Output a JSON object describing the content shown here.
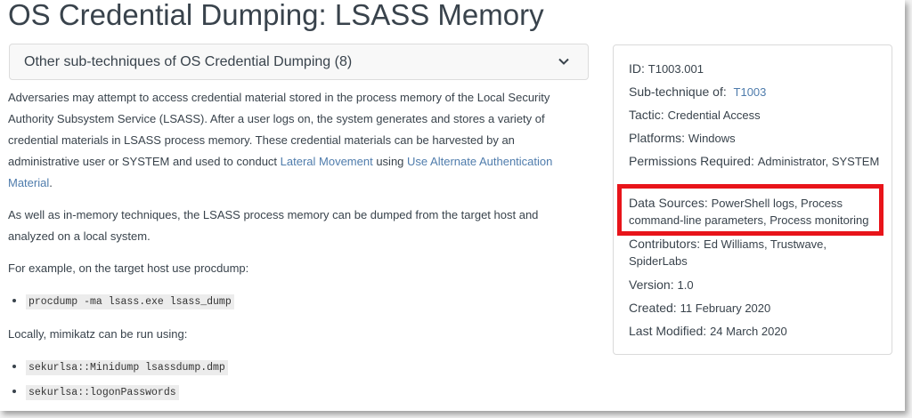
{
  "page": {
    "title": "OS Credential Dumping: LSASS Memory"
  },
  "subtechniques_dropdown": {
    "label": "Other sub-techniques of OS Credential Dumping (8)",
    "icon": "chevron-down-icon"
  },
  "body": {
    "p1_text": "Adversaries may attempt to access credential material stored in the process memory of the Local Security Authority Subsystem Service (LSASS). After a user logs on, the system generates and stores a variety of credential materials in LSASS process memory. These credential materials can be harvested by an administrative user or SYSTEM and used to conduct ",
    "p1_link1": "Lateral Movement",
    "p1_mid": " using ",
    "p1_link2": "Use Alternate Authentication Material",
    "p1_end": ".",
    "p2": "As well as in-memory techniques, the LSASS process memory can be dumped from the target host and analyzed on a local system.",
    "p3": "For example, on the target host use procdump:",
    "procdump_cmd": "procdump -ma lsass.exe lsass_dump",
    "p4": "Locally, mimikatz can be run using:",
    "mimikatz_cmd1": "sekurlsa::Minidump lsassdump.dmp",
    "mimikatz_cmd2": "sekurlsa::logonPasswords"
  },
  "card": {
    "id_label": "ID:",
    "id_value": "T1003.001",
    "subtech_label": "Sub-technique of:",
    "subtech_link": "T1003",
    "tactic_label": "Tactic:",
    "tactic_value": "Credential Access",
    "platforms_label": "Platforms:",
    "platforms_value": "Windows",
    "permissions_label": "Permissions Required:",
    "permissions_value": "Administrator, SYSTEM",
    "datasources_label": "Data Sources:",
    "datasources_value": "PowerShell logs, Process command-line parameters, Process monitoring",
    "contributors_label": "Contributors:",
    "contributors_value": "Ed Williams, Trustwave, SpiderLabs",
    "version_label": "Version:",
    "version_value": "1.0",
    "created_label": "Created:",
    "created_value": "11 February 2020",
    "modified_label": "Last Modified:",
    "modified_value": "24 March 2020"
  },
  "colors": {
    "highlight_border": "#e8141a",
    "link": "#4f7cac",
    "text": "#39434c"
  }
}
